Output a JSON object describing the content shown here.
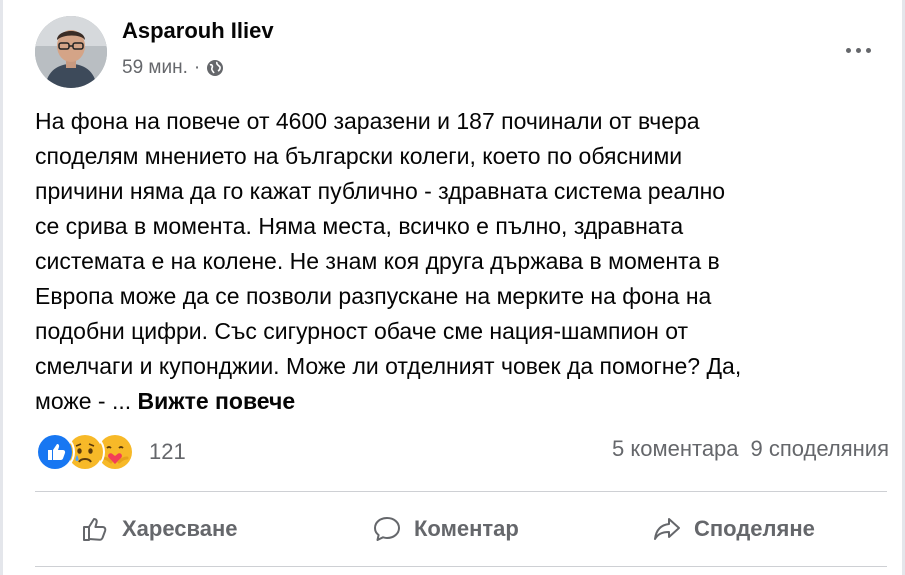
{
  "post": {
    "author": "Asparouh Iliev",
    "time": "59 мин.",
    "separator": "·",
    "privacy_icon": "globe-icon",
    "more_icon": "more-options-icon",
    "lines": [
      "На фона на повече от 4600 заразени и 187 починали от вчера",
      "споделям мнението на български колеги, което по обясними",
      "причини няма да го кажат публично - здравната система реално",
      "се срива в момента. Няма места, всичко е пълно, здравната",
      "системата е на колене. Не знам коя друга държава в момента в",
      "Европа може да се позволи разпускане на мерките на фона на",
      "подобни цифри. Със сигурност обаче сме нация-шампион от",
      "смелчаги и купонджии. Може ли отделният човек да помогне? Да,",
      "може - ... "
    ],
    "see_more": "Вижте повече"
  },
  "reactions": {
    "icons": [
      "like-reaction-icon",
      "sad-reaction-icon",
      "care-reaction-icon"
    ],
    "count": "121"
  },
  "stats": {
    "comments": "5 коментара",
    "shares": "9 споделяния"
  },
  "actions": {
    "like": "Харесване",
    "comment": "Коментар",
    "share": "Споделяне"
  },
  "colors": {
    "secondary_text": "#65676b",
    "like_blue": "#1877f2",
    "sad_yellow": "#f7b928",
    "care_red": "#f33e58"
  }
}
